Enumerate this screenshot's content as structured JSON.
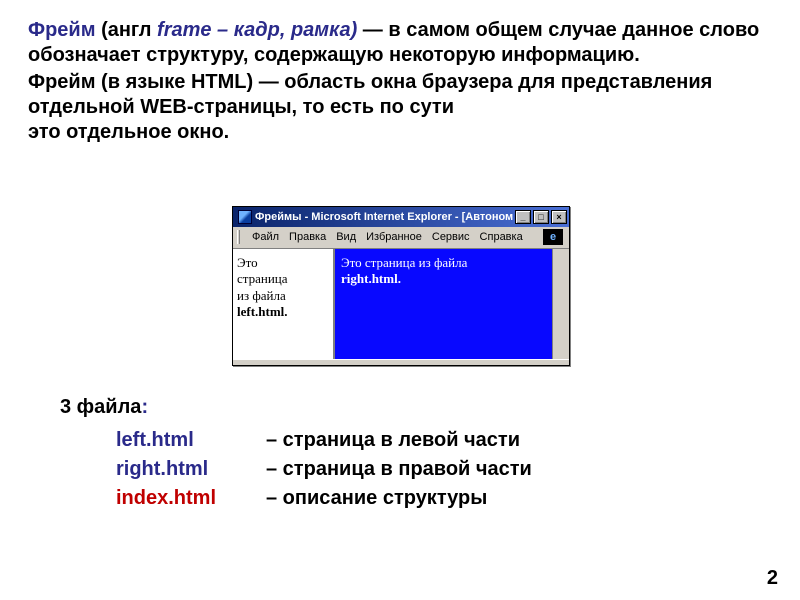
{
  "text": {
    "term1": "Фрейм",
    "term1_paren_prefix": "(англ ",
    "term1_italic": "frame – кадр, рамка)",
    "def1_rest": "  — в самом общем случае данное слово обозначает структуру, содержащую некоторую информацию.",
    "term2": "Фрейм (в языке HTML) — область окна браузера для представления отдельной WEB-страницы, то есть по   сути",
    "term2_tail": "это отдельное окно."
  },
  "browser": {
    "title": "Фреймы - Microsoft Internet Explorer - [Автоном...",
    "menus": [
      "Файл",
      "Правка",
      "Вид",
      "Избранное",
      "Сервис",
      "Справка"
    ],
    "left_frame_lines": [
      "Это",
      "страница",
      "из файла",
      "left.html."
    ],
    "right_frame_lines": [
      "Это страница из файла",
      "right.html."
    ],
    "btn_min": "_",
    "btn_max": "□",
    "btn_close": "×",
    "logo_glyph": "e"
  },
  "files": {
    "label": "3 файла",
    "colon": ":",
    "rows": [
      {
        "name": "left.html",
        "desc": "– страница в левой части",
        "class": "blue"
      },
      {
        "name": "right.html",
        "desc": "– страница в правой части",
        "class": "blue"
      },
      {
        "name": "index.html",
        "desc": "– описание структуры",
        "class": "red"
      }
    ]
  },
  "page_number": "2"
}
